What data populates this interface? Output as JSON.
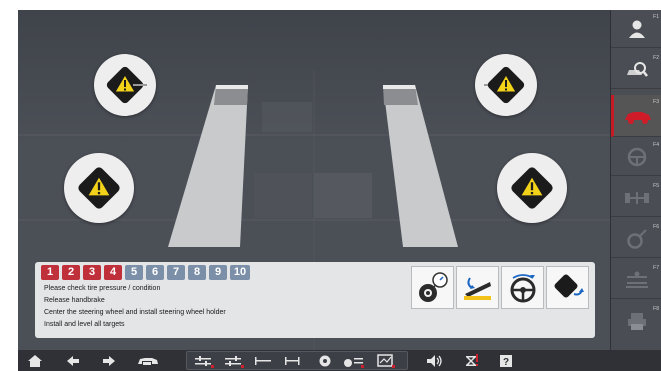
{
  "steps": [
    {
      "label": "1",
      "state": "done"
    },
    {
      "label": "2",
      "state": "done"
    },
    {
      "label": "3",
      "state": "done"
    },
    {
      "label": "4",
      "state": "done"
    },
    {
      "label": "5",
      "state": "todo"
    },
    {
      "label": "6",
      "state": "todo"
    },
    {
      "label": "7",
      "state": "todo"
    },
    {
      "label": "8",
      "state": "todo"
    },
    {
      "label": "9",
      "state": "todo"
    },
    {
      "label": "10",
      "state": "todo"
    }
  ],
  "instructions": [
    "Please check tire pressure / condition",
    "Release handbrake",
    "Center the steering wheel and install steering wheel holder",
    "Install and level all targets"
  ],
  "action_icons": [
    "tire-pressure-icon",
    "handbrake-release-icon",
    "steering-wheel-center-icon",
    "target-level-icon"
  ],
  "sidebar": {
    "keys": [
      {
        "label": "F1",
        "icon": "person-icon",
        "active": false
      },
      {
        "label": "F2",
        "icon": "vehicle-search-icon",
        "active": false
      },
      {
        "label": "F3",
        "icon": "car-icon",
        "active": true
      },
      {
        "label": "F4",
        "icon": "steering-wheel-icon",
        "active": false
      },
      {
        "label": "F5",
        "icon": "axle-icon",
        "active": false
      },
      {
        "label": "F6",
        "icon": "wheel-adjust-icon",
        "active": false
      },
      {
        "label": "F7",
        "icon": "lift-icon",
        "active": false
      },
      {
        "label": "F8",
        "icon": "printer-icon",
        "active": false
      }
    ]
  },
  "toolbar": {
    "items": [
      "home-icon",
      "back-arrow-icon",
      "forward-arrow-icon",
      "vehicle-db-icon",
      "adjust-1-icon",
      "adjust-2-icon",
      "track-width-icon",
      "wheelbase-icon",
      "wheel-icon",
      "camber-icon",
      "report-icon",
      "volume-icon",
      "lift-icon",
      "help-icon"
    ]
  },
  "colors": {
    "stage_bg": "#4a4e55",
    "step_done": "#c0303a",
    "step_todo": "#7c8fa8",
    "warning_yellow": "#f3d21a",
    "accent_red": "#c81a25"
  }
}
